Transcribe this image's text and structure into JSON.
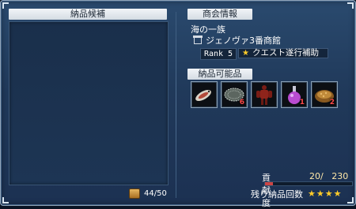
{
  "candidates": {
    "title": "納品候補",
    "capacity": "44/50",
    "capacity_icon": "treasure-box-icon"
  },
  "guild": {
    "title": "商会情報",
    "name": "海の一族",
    "shop": "ジェノヴァ3番商館",
    "shop_icon": "shop-icon",
    "rank": "Rank 5",
    "quest_label": "クエスト遂行補助",
    "quest_icon": "star-badge-icon"
  },
  "deliverables": {
    "title": "納品可能品",
    "items": [
      {
        "icon": "fish-icon",
        "qty": ""
      },
      {
        "icon": "fishing-net-icon",
        "qty": "6"
      },
      {
        "icon": "red-armor-icon",
        "qty": ""
      },
      {
        "icon": "potion-flask-icon",
        "qty": "1"
      },
      {
        "icon": "grain-pile-icon",
        "qty": "2"
      }
    ]
  },
  "contribution": {
    "label": "貢献度",
    "value": "20/",
    "max": "230",
    "progress": 0.087,
    "bar_color": "#cc4444"
  },
  "remaining": {
    "label": "残り納品回数",
    "stars": "★★★★",
    "count": 4
  }
}
